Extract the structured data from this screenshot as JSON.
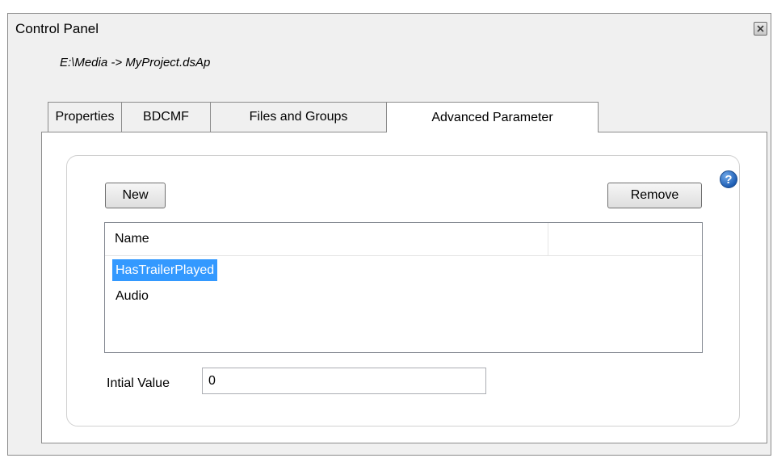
{
  "window": {
    "title": "Control Panel"
  },
  "path": "E:\\Media -> MyProject.dsAp",
  "tabs": [
    {
      "label": "Properties",
      "active": false
    },
    {
      "label": "BDCMF",
      "active": false
    },
    {
      "label": "Files and Groups",
      "active": false
    },
    {
      "label": "Advanced Parameter",
      "active": true
    }
  ],
  "panel": {
    "help_icon": "help-icon",
    "new_label": "New",
    "remove_label": "Remove",
    "list": {
      "columns": [
        "Name",
        ""
      ],
      "rows": [
        {
          "name": "HasTrailerPlayed",
          "selected": true
        },
        {
          "name": "Audio",
          "selected": false
        }
      ]
    },
    "initial_value_label": "Intial Value",
    "initial_value": "0"
  },
  "colors": {
    "selection": "#3399ff",
    "window_bg": "#f0f0f0",
    "help_icon": "#1f5fb5"
  }
}
